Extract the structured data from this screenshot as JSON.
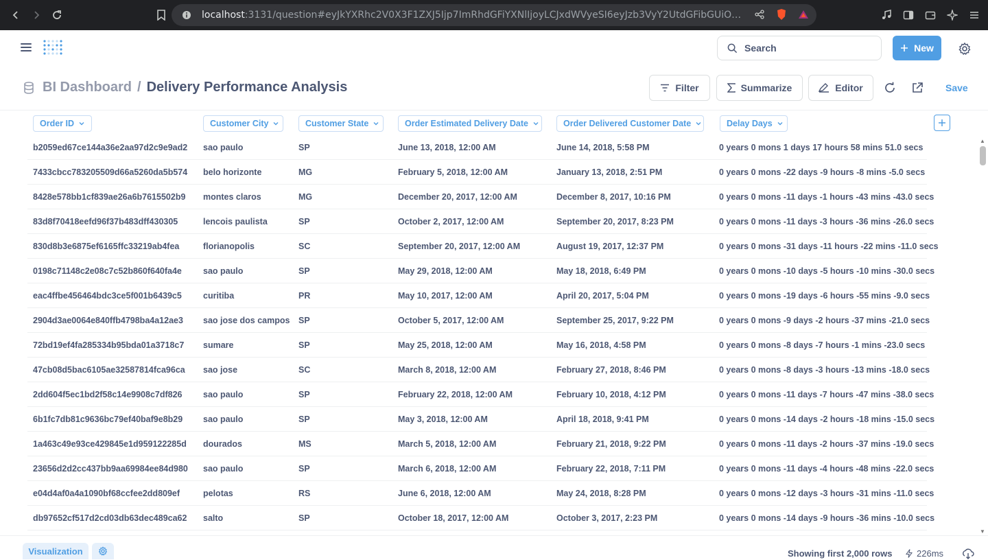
{
  "browser": {
    "url_host": "localhost",
    "url_rest": ":3131/question#eyJkYXRhc2V0X3F1ZXJ5Ijp7ImRhdGFiYXNlIjoyLCJxdWVyeSI6eyJzb3VyY2UtdGFibGUiOjEzfSwidHl..."
  },
  "app": {
    "search_label": "Search",
    "new_label": "New"
  },
  "header": {
    "collection": "BI Dashboard",
    "separator": "/",
    "title": "Delivery Performance Analysis",
    "filter_label": "Filter",
    "summarize_label": "Summarize",
    "editor_label": "Editor",
    "save_label": "Save"
  },
  "table": {
    "columns": [
      "Order ID",
      "Customer City",
      "Customer State",
      "Order Estimated Delivery Date",
      "Order Delivered Customer Date",
      "Delay Days"
    ],
    "rows": [
      [
        "b2059ed67ce144a36e2aa97d2c9e9ad2",
        "sao paulo",
        "SP",
        "June 13, 2018, 12:00 AM",
        "June 14, 2018, 5:58 PM",
        "0 years 0 mons 1 days 17 hours 58 mins 51.0 secs"
      ],
      [
        "7433cbcc783205509d66a5260da5b574",
        "belo horizonte",
        "MG",
        "February 5, 2018, 12:00 AM",
        "January 13, 2018, 2:51 PM",
        "0 years 0 mons -22 days -9 hours -8 mins -5.0 secs"
      ],
      [
        "8428e578bb1cf839ae26a6b7615502b9",
        "montes claros",
        "MG",
        "December 20, 2017, 12:00 AM",
        "December 8, 2017, 10:16 PM",
        "0 years 0 mons -11 days -1 hours -43 mins -43.0 secs"
      ],
      [
        "83d8f70418eefd96f37b483dff430305",
        "lencois paulista",
        "SP",
        "October 2, 2017, 12:00 AM",
        "September 20, 2017, 8:23 PM",
        "0 years 0 mons -11 days -3 hours -36 mins -26.0 secs"
      ],
      [
        "830d8b3e6875ef6165ffc33219ab4fea",
        "florianopolis",
        "SC",
        "September 20, 2017, 12:00 AM",
        "August 19, 2017, 12:37 PM",
        "0 years 0 mons -31 days -11 hours -22 mins -11.0 secs"
      ],
      [
        "0198c71148c2e08c7c52b860f640fa4e",
        "sao paulo",
        "SP",
        "May 29, 2018, 12:00 AM",
        "May 18, 2018, 6:49 PM",
        "0 years 0 mons -10 days -5 hours -10 mins -30.0 secs"
      ],
      [
        "eac4ffbe456464bdc3ce5f001b6439c5",
        "curitiba",
        "PR",
        "May 10, 2017, 12:00 AM",
        "April 20, 2017, 5:04 PM",
        "0 years 0 mons -19 days -6 hours -55 mins -9.0 secs"
      ],
      [
        "2904d3ae0064e840ffb4798ba4a12ae3",
        "sao jose dos campos",
        "SP",
        "October 5, 2017, 12:00 AM",
        "September 25, 2017, 9:22 PM",
        "0 years 0 mons -9 days -2 hours -37 mins -21.0 secs"
      ],
      [
        "72bd19ef4fa285334b95bda01a3718c7",
        "sumare",
        "SP",
        "May 25, 2018, 12:00 AM",
        "May 16, 2018, 4:58 PM",
        "0 years 0 mons -8 days -7 hours -1 mins -23.0 secs"
      ],
      [
        "47cb08d5bac6105ae32587814fca96ca",
        "sao jose",
        "SC",
        "March 8, 2018, 12:00 AM",
        "February 27, 2018, 8:46 PM",
        "0 years 0 mons -8 days -3 hours -13 mins -18.0 secs"
      ],
      [
        "2dd604f5ec1bd2f58c14e9908c7df826",
        "sao paulo",
        "SP",
        "February 22, 2018, 12:00 AM",
        "February 10, 2018, 4:12 PM",
        "0 years 0 mons -11 days -7 hours -47 mins -38.0 secs"
      ],
      [
        "6b1fc7db81c9636bc79ef40baf9e8b29",
        "sao paulo",
        "SP",
        "May 3, 2018, 12:00 AM",
        "April 18, 2018, 9:41 PM",
        "0 years 0 mons -14 days -2 hours -18 mins -15.0 secs"
      ],
      [
        "1a463c49e93ce429845e1d959122285d",
        "dourados",
        "MS",
        "March 5, 2018, 12:00 AM",
        "February 21, 2018, 9:22 PM",
        "0 years 0 mons -11 days -2 hours -37 mins -19.0 secs"
      ],
      [
        "23656d2d2cc437bb9aa69984ee84d980",
        "sao paulo",
        "SP",
        "March 6, 2018, 12:00 AM",
        "February 22, 2018, 7:11 PM",
        "0 years 0 mons -11 days -4 hours -48 mins -22.0 secs"
      ],
      [
        "e04d4af0a4a1090bf68ccfee2dd809ef",
        "pelotas",
        "RS",
        "June 6, 2018, 12:00 AM",
        "May 24, 2018, 8:28 PM",
        "0 years 0 mons -12 days -3 hours -31 mins -11.0 secs"
      ],
      [
        "db97652cf517d2cd03db63dec489ca62",
        "salto",
        "SP",
        "October 18, 2017, 12:00 AM",
        "October 3, 2017, 2:23 PM",
        "0 years 0 mons -14 days -9 hours -36 mins -10.0 secs"
      ]
    ]
  },
  "footer": {
    "visualization_label": "Visualization",
    "row_count": "Showing first 2,000 rows",
    "timing": "226ms"
  },
  "colors": {
    "brand": "#509ee3",
    "text": "#4c5773",
    "muted": "#949aab"
  }
}
